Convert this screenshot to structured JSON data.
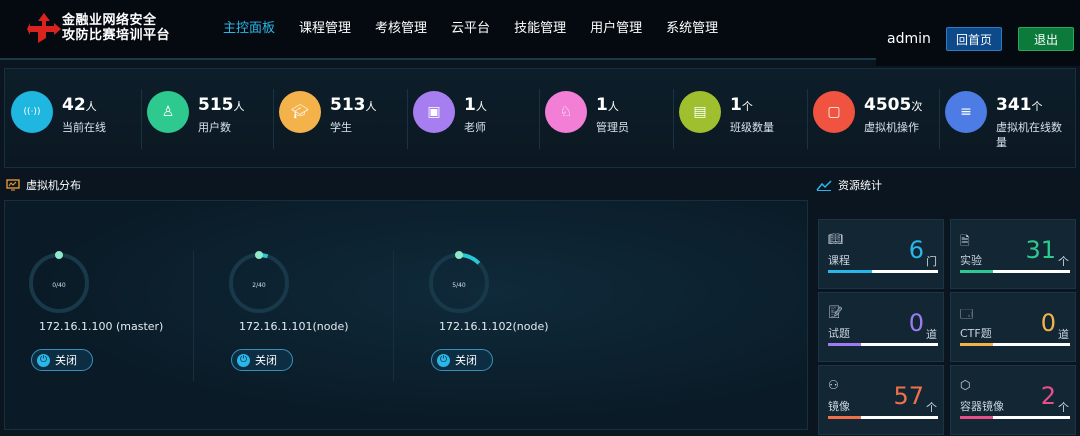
{
  "header": {
    "brand_line1": "金融业网络安全",
    "brand_line2": "攻防比赛培训平台",
    "nav": [
      "主控面板",
      "课程管理",
      "考核管理",
      "云平台",
      "技能管理",
      "用户管理",
      "系统管理"
    ],
    "active_nav": "主控面板",
    "user": "admin",
    "home_label": "回首页",
    "exit_label": "退出"
  },
  "stats": [
    {
      "value": "42",
      "unit": "人",
      "label": "当前在线",
      "icon": "wifi-icon",
      "color": "#1fb7e0"
    },
    {
      "value": "515",
      "unit": "人",
      "label": "用户数",
      "icon": "user-icon",
      "color": "#2ec98f"
    },
    {
      "value": "513",
      "unit": "人",
      "label": "学生",
      "icon": "graduation-cap-icon",
      "color": "#f4b24a"
    },
    {
      "value": "1",
      "unit": "人",
      "label": "老师",
      "icon": "teacher-icon",
      "color": "#a77ef0"
    },
    {
      "value": "1",
      "unit": "人",
      "label": "管理员",
      "icon": "admin-icon",
      "color": "#f27fd5"
    },
    {
      "value": "1",
      "unit": "个",
      "label": "班级数量",
      "icon": "class-icon",
      "color": "#9fbf2e"
    },
    {
      "value": "4505",
      "unit": "次",
      "label": "虚拟机操作",
      "icon": "vm-op-icon",
      "color": "#f0533f"
    },
    {
      "value": "341",
      "unit": "个",
      "label": "虚拟机在线数量",
      "icon": "vm-online-icon",
      "color": "#4c7ce4"
    }
  ],
  "vm_section": {
    "title": "虚拟机分布",
    "machines": [
      {
        "usage": "0/40",
        "used": 0,
        "total": 40,
        "ip": "172.16.1.100 (master)",
        "power_label": "关闭"
      },
      {
        "usage": "2/40",
        "used": 2,
        "total": 40,
        "ip": "172.16.1.101(node)",
        "power_label": "关闭"
      },
      {
        "usage": "5/40",
        "used": 5,
        "total": 40,
        "ip": "172.16.1.102(node)",
        "power_label": "关闭"
      }
    ]
  },
  "resources": {
    "title": "资源统计",
    "items": [
      {
        "label": "课程",
        "value": "6",
        "unit": "门",
        "color": "#29b6e8",
        "fill": 0.4,
        "icon": "book-icon"
      },
      {
        "label": "实验",
        "value": "31",
        "unit": "个",
        "color": "#2ec98f",
        "fill": 0.3,
        "icon": "experiment-icon"
      },
      {
        "label": "试题",
        "value": "0",
        "unit": "道",
        "color": "#9c7cf0",
        "fill": 0.3,
        "icon": "exam-icon"
      },
      {
        "label": "CTF题",
        "value": "0",
        "unit": "道",
        "color": "#f4b24a",
        "fill": 0.3,
        "icon": "ctf-icon"
      },
      {
        "label": "镜像",
        "value": "57",
        "unit": "个",
        "color": "#f0704a",
        "fill": 0.3,
        "icon": "image-icon"
      },
      {
        "label": "容器镜像",
        "value": "2",
        "unit": "个",
        "color": "#e84f8a",
        "fill": 0.3,
        "icon": "container-icon"
      }
    ]
  }
}
